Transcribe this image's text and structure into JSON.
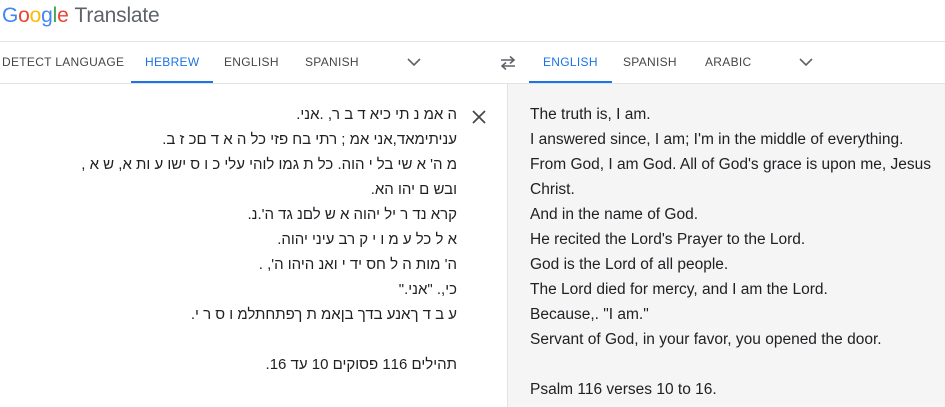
{
  "app": {
    "logo_letters": [
      "G",
      "o",
      "o",
      "g",
      "l",
      "e"
    ],
    "product": "Translate"
  },
  "source_langs": {
    "tabs": [
      "DETECT LANGUAGE",
      "HEBREW",
      "ENGLISH",
      "SPANISH"
    ],
    "active": "HEBREW"
  },
  "target_langs": {
    "tabs": [
      "ENGLISH",
      "SPANISH",
      "ARABIC"
    ],
    "active": "ENGLISH"
  },
  "colors": {
    "accent": "#1a73e8",
    "google_blue": "#4285f4",
    "google_red": "#ea4335",
    "google_yellow": "#fbbc05",
    "google_green": "#34a853",
    "output_bg": "#f5f5f5"
  },
  "icons": {
    "swap": "swap-arrows-icon",
    "more": "chevron-down-icon",
    "clear": "close-icon"
  },
  "source": {
    "lines": [
      "ה אמ נ תי כיא ד ב ר,  .אני.",
      "עניתימאד,אני אמ ; רתי  בח פזי כל ה א ד םכ ז ב.",
      "מ ה' א שי בל י הוה. כל ת גמו לוהי עלי כ ו ס ישו ע ות א, ש א ,",
      "ובש ם יהו הא.",
      "קרא נד ר יל יהוה א ש לםנ גד ה'.נ.",
      "א ל כל ע מ ו י ק רב עיני יהוה.",
      "ה' מות ה ל חס יד י ואנ היהו ה',  .",
      "כי,. \"אני.\"",
      "ע ב ד ךאנע בדך בןאמ ת ךפתחתלמ ו ס ר י."
    ],
    "reference": "תהילים 116 פסוקים 10 עד 16."
  },
  "translation": {
    "lines": [
      "The truth is, I am.",
      "I answered since, I am; I'm in the middle of everything.",
      "From God, I am God. All of God's grace is upon me, Jesus",
      "Christ.",
      "And in the name of God.",
      "He recited the Lord's Prayer to the Lord.",
      "God is the Lord of all people.",
      "The Lord died for mercy, and I am the Lord.",
      "Because,. \"I am.\"",
      "Servant of God, in your favor, you opened the door."
    ],
    "reference": "Psalm 116 verses 10 to 16."
  }
}
